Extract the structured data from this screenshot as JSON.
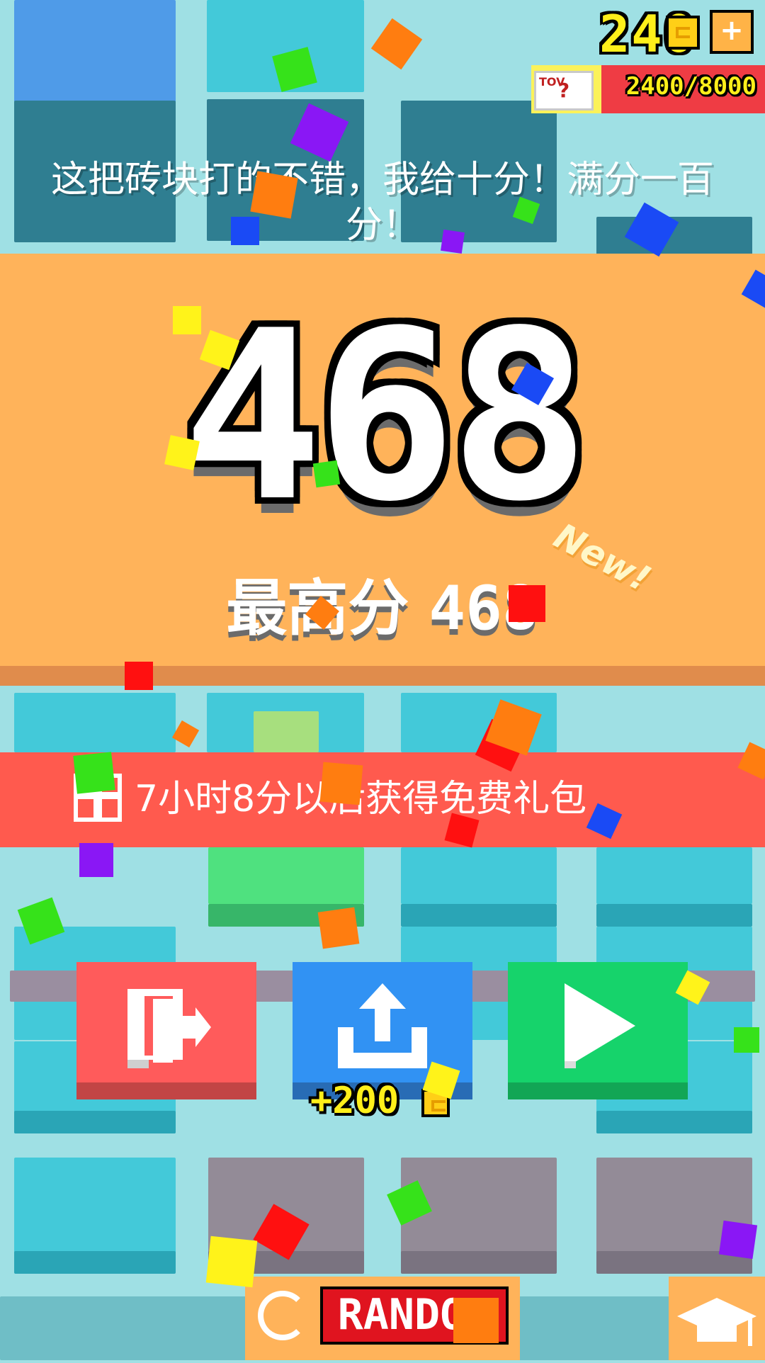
{
  "coins": {
    "count": "240",
    "add_label": "+",
    "coin_icon": "coin-icon"
  },
  "prize_progress": {
    "text": "2400/8000",
    "current": 2400,
    "total": 8000,
    "fraction": 0.3,
    "icon_label": "TOV",
    "icon_glyph": "?"
  },
  "comment": "这把砖块打的不错，我给十分！满分一百分！",
  "score": {
    "value": "468",
    "best_label": "最高分",
    "best_value": "468",
    "new_label": "New!"
  },
  "gift": {
    "text": "7小时8分以后获得免费礼包"
  },
  "actions": {
    "exit_icon": "exit-door-icon",
    "share_icon": "share-upload-icon",
    "play_icon": "play-icon",
    "share_reward": "+200"
  },
  "bottom": {
    "random_label": "RANDOM",
    "random_icon": "refresh-icon",
    "grad_icon": "graduation-cap-icon"
  },
  "colors": {
    "panel": "#ffb35a",
    "banner": "#ff5a4e",
    "exit": "#ff5b5b",
    "share": "#3192f3",
    "play": "#16d36b",
    "coin_text": "#ffef1a"
  }
}
